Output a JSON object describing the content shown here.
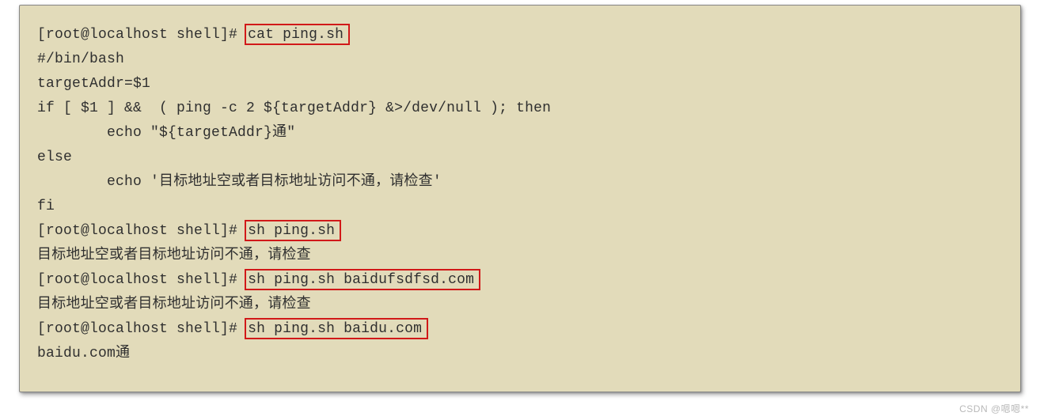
{
  "terminal": {
    "prompt": "[root@localhost shell]#",
    "lines": {
      "l1_prompt": "[root@localhost shell]#",
      "l1_sp": " ",
      "l1_cmd": "cat ping.sh",
      "l2": "#/bin/bash",
      "l3": "",
      "l4": "targetAddr=$1",
      "l5": "if [ $1 ] &&  ( ping -c 2 ${targetAddr} &>/dev/null ); then",
      "l6": "        echo \"${targetAddr}通\"",
      "l7": "else",
      "l8": "        echo '目标地址空或者目标地址访问不通，请检查'",
      "l9": "fi",
      "l10_prompt": "[root@localhost shell]#",
      "l10_sp": " ",
      "l10_cmd": "sh ping.sh",
      "l11": "目标地址空或者目标地址访问不通，请检查",
      "l12_prompt": "[root@localhost shell]#",
      "l12_sp": " ",
      "l12_cmd": "sh ping.sh baidufsdfsd.com",
      "l13": "目标地址空或者目标地址访问不通，请检查",
      "l14_prompt": "[root@localhost shell]#",
      "l14_sp": " ",
      "l14_cmd": "sh ping.sh baidu.com",
      "l15": "baidu.com通"
    }
  },
  "watermark": "CSDN @嗯嗯**"
}
